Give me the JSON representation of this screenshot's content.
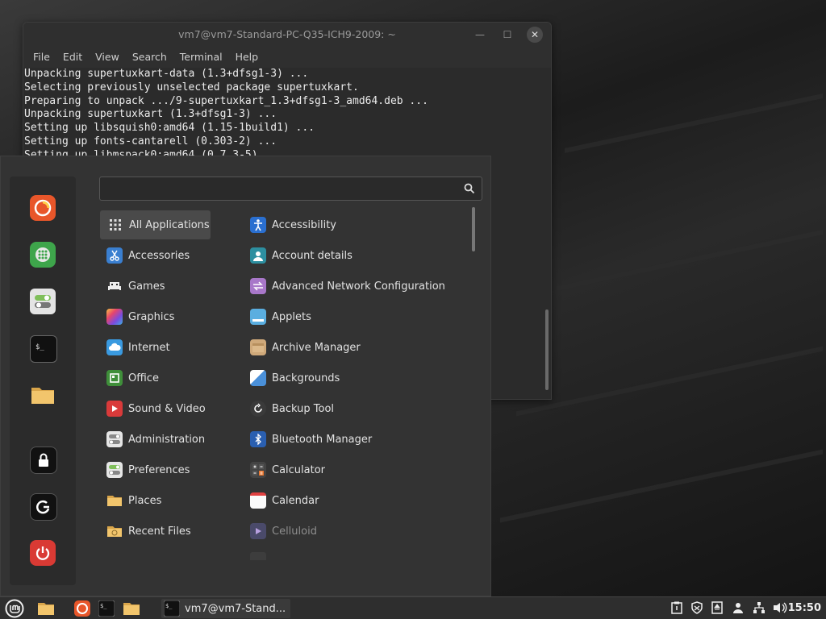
{
  "terminal": {
    "title": "vm7@vm7-Standard-PC-Q35-ICH9-2009: ~",
    "menu": [
      "File",
      "Edit",
      "View",
      "Search",
      "Terminal",
      "Help"
    ],
    "lines": [
      "Unpacking supertuxkart-data (1.3+dfsg1-3) ...",
      "Selecting previously unselected package supertuxkart.",
      "Preparing to unpack .../9-supertuxkart_1.3+dfsg1-3_amd64.deb ...",
      "Unpacking supertuxkart (1.3+dfsg1-3) ...",
      "Setting up libsquish0:amd64 (1.15-1build1) ...",
      "Setting up fonts-cantarell (0.303-2) ...",
      "Setting up libmspack0:amd64 (0.7.3-5) ..."
    ]
  },
  "menu": {
    "search": {
      "value": "",
      "placeholder": ""
    },
    "favorites": [
      {
        "name": "firefox",
        "icon": "firefox-icon"
      },
      {
        "name": "software-manager",
        "icon": "software-manager-icon"
      },
      {
        "name": "system-settings",
        "icon": "settings-toggle-icon"
      },
      {
        "name": "terminal",
        "icon": "terminal-icon"
      },
      {
        "name": "files",
        "icon": "folder-icon"
      },
      {
        "name": "lock-screen",
        "icon": "lock-icon"
      },
      {
        "name": "logout",
        "icon": "logout-icon"
      },
      {
        "name": "shutdown",
        "icon": "power-icon"
      }
    ],
    "categories": [
      {
        "label": "All Applications",
        "icon": "grid-icon",
        "selected": true
      },
      {
        "label": "Accessories",
        "icon": "scissors-icon"
      },
      {
        "label": "Games",
        "icon": "gamepad-icon"
      },
      {
        "label": "Graphics",
        "icon": "graphics-icon"
      },
      {
        "label": "Internet",
        "icon": "cloud-icon"
      },
      {
        "label": "Office",
        "icon": "office-icon"
      },
      {
        "label": "Sound & Video",
        "icon": "play-icon"
      },
      {
        "label": "Administration",
        "icon": "toggle-icon"
      },
      {
        "label": "Preferences",
        "icon": "toggle-icon"
      },
      {
        "label": "Places",
        "icon": "folder-icon"
      },
      {
        "label": "Recent Files",
        "icon": "recent-folder-icon"
      }
    ],
    "apps": [
      {
        "label": "Accessibility",
        "icon": "accessibility-icon"
      },
      {
        "label": "Account details",
        "icon": "account-icon"
      },
      {
        "label": "Advanced Network Configuration",
        "icon": "network-icon"
      },
      {
        "label": "Applets",
        "icon": "applets-icon"
      },
      {
        "label": "Archive Manager",
        "icon": "archive-icon"
      },
      {
        "label": "Backgrounds",
        "icon": "backgrounds-icon"
      },
      {
        "label": "Backup Tool",
        "icon": "backup-icon"
      },
      {
        "label": "Bluetooth Manager",
        "icon": "bluetooth-icon"
      },
      {
        "label": "Calculator",
        "icon": "calculator-icon"
      },
      {
        "label": "Calendar",
        "icon": "calendar-icon"
      },
      {
        "label": "Celluloid",
        "icon": "celluloid-icon"
      }
    ]
  },
  "taskbar": {
    "window_label": "vm7@vm7-Stand...",
    "clock": "15:50"
  }
}
